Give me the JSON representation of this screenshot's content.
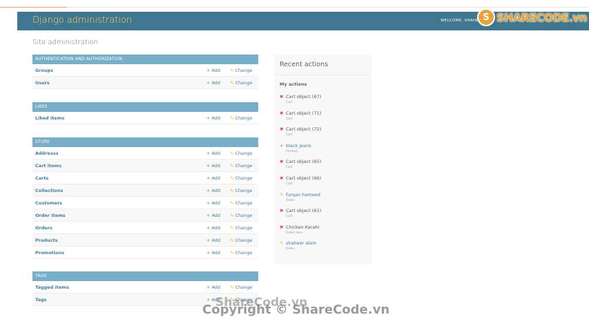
{
  "header": {
    "title": "Django administration",
    "user_tools": "WELCOME, SHAHE"
  },
  "logo": {
    "icon": "S",
    "text": "SHARECODE.vn"
  },
  "page_title": "Site administration",
  "modules": [
    {
      "caption": "AUTHENTICATION AND AUTHORIZATION",
      "rows": [
        {
          "name": "Groups",
          "add": "Add",
          "change": "Change"
        },
        {
          "name": "Users",
          "add": "Add",
          "change": "Change"
        }
      ]
    },
    {
      "caption": "LIKES",
      "rows": [
        {
          "name": "Liked items",
          "add": "Add",
          "change": "Change"
        }
      ]
    },
    {
      "caption": "STORE",
      "rows": [
        {
          "name": "Addresss",
          "add": "Add",
          "change": "Change"
        },
        {
          "name": "Cart items",
          "add": "Add",
          "change": "Change"
        },
        {
          "name": "Carts",
          "add": "Add",
          "change": "Change"
        },
        {
          "name": "Collections",
          "add": "Add",
          "change": "Change"
        },
        {
          "name": "Customers",
          "add": "Add",
          "change": "Change"
        },
        {
          "name": "Order items",
          "add": "Add",
          "change": "Change"
        },
        {
          "name": "Orders",
          "add": "Add",
          "change": "Change"
        },
        {
          "name": "Products",
          "add": "Add",
          "change": "Change"
        },
        {
          "name": "Promotions",
          "add": "Add",
          "change": "Change"
        }
      ]
    },
    {
      "caption": "TAGS",
      "rows": [
        {
          "name": "Tagged items",
          "add": "Add",
          "change": "Change"
        },
        {
          "name": "Tags",
          "add": "Add",
          "change": "Change"
        }
      ]
    }
  ],
  "recent": {
    "title": "Recent actions",
    "subtitle": "My actions",
    "items": [
      {
        "action": "delete",
        "label": "Cart object (67)",
        "type": "Cart"
      },
      {
        "action": "delete",
        "label": "Cart object (71)",
        "type": "Cart"
      },
      {
        "action": "delete",
        "label": "Cart object (72)",
        "type": "Cart"
      },
      {
        "action": "add",
        "label": "black jeans",
        "type": "Product"
      },
      {
        "action": "delete",
        "label": "Cart object (65)",
        "type": "Cart"
      },
      {
        "action": "delete",
        "label": "Cart object (66)",
        "type": "Cart"
      },
      {
        "action": "change",
        "label": "furqan hameed",
        "type": "Order"
      },
      {
        "action": "delete",
        "label": "Cart object (61)",
        "type": "Cart"
      },
      {
        "action": "delete",
        "label": "Chicken Karahi",
        "type": "Order item"
      },
      {
        "action": "change",
        "label": "shaheer alam",
        "type": "Order"
      }
    ]
  },
  "watermark": {
    "line1": "ShareCode.vn",
    "line2": "Copyright © ShareCode.vn"
  },
  "colors": {
    "header_bg": "#417690",
    "branding": "#f5dd5d",
    "module_caption": "#79aec8",
    "link": "#447e9b",
    "add_icon": "#70bf2b",
    "change_icon": "#efb80b",
    "delete_icon": "#dd4646"
  }
}
